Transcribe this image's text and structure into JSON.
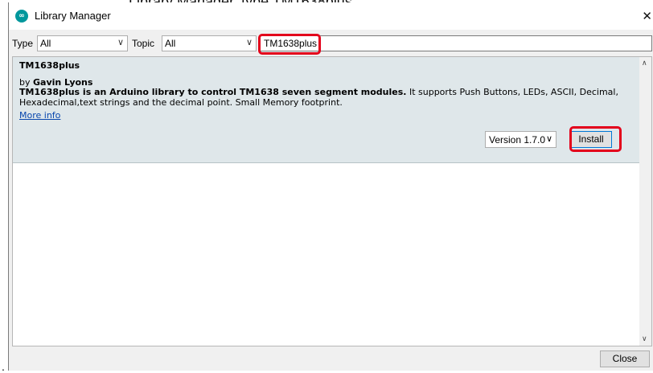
{
  "window": {
    "title": "Library Manager",
    "app_icon_glyph": "∞",
    "close_glyph": "✕"
  },
  "filters": {
    "type_label": "Type",
    "type_value": "All",
    "topic_label": "Topic",
    "topic_value": "All",
    "search_value": "TM1638plus"
  },
  "library": {
    "name": "TM1638plus",
    "by_prefix": "by",
    "author": "Gavin Lyons",
    "description_bold": "TM1638plus is an Arduino library to control TM1638 seven segment modules.",
    "description_rest": " It supports Push Buttons, LEDs, ASCII, Decimal, Hexadecimal,text strings and the decimal point. Small Memory footprint.",
    "more_info": "More info",
    "version": "Version 1.7.0",
    "install_label": "Install"
  },
  "footer": {
    "close_label": "Close"
  },
  "page_fragment": {
    "bullet": "."
  },
  "colors": {
    "highlight": "#e3001b",
    "card_bg": "#dfe7ea",
    "link": "#0645ad"
  },
  "icons": {
    "chevron": "∨",
    "scroll_up": "∧",
    "scroll_down": "∨"
  }
}
